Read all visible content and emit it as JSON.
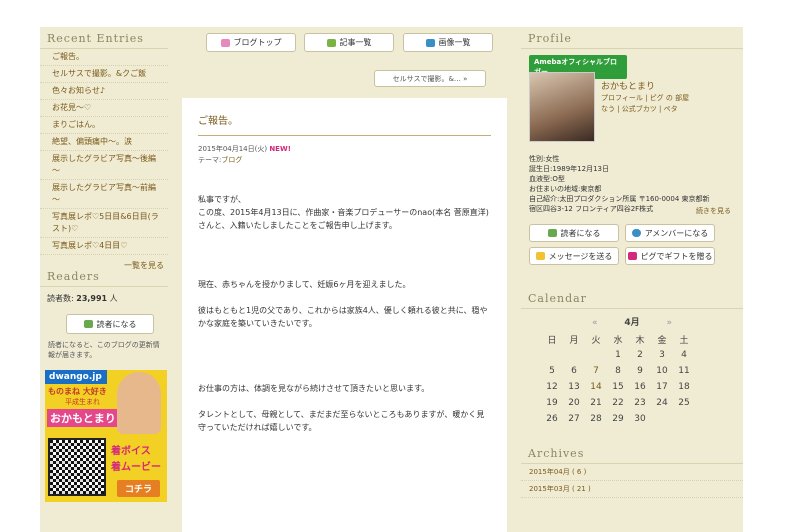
{
  "recent_entries": {
    "title": "Recent Entries",
    "items": [
      "ご報告。",
      "セルサスで撮影。&クご飯",
      "色々お知らせ♪",
      "お花見～♡",
      "まりごはん。",
      "絶望、偏頭痛中～。涙",
      "展示したグラビア写真～後編～",
      "展示したグラビア写真～前編～",
      "写真展レポ♡5日目&6日目(ラスト)♡",
      "写真展レポ♡4日目♡"
    ],
    "more": "一覧を見る"
  },
  "readers": {
    "title": "Readers",
    "count_label": "読者数:",
    "count": "23,991",
    "unit": "人",
    "button": "読者になる",
    "note": "読者になると、このブログの更新情報が届きます。"
  },
  "banner": {
    "top": "dwango.jp",
    "line1": "ものまね 大好き",
    "line2": "平成生まれ",
    "name": "おかもとまり",
    "voice": "着ボイス",
    "movie": "着ムービー",
    "cta": "コチラ"
  },
  "nav": {
    "blog_top": "ブログトップ",
    "entries": "記事一覧",
    "images": "画像一覧",
    "next": "セルサスで撮影。&… »"
  },
  "post": {
    "title": "ご報告。",
    "date": "2015年04月14日(火)",
    "new": "NEW!",
    "theme_label": "テーマ:",
    "theme": "ブログ",
    "p1": "私事ですが、",
    "p2": "この度、2015年4月13日に、作曲家・音楽プロデューサーのnao(本名 菅原直洋)さんと、入籍いたしましたことをご報告申し上げます。",
    "p3": "現在、赤ちゃんを授かりまして、妊娠6ヶ月を迎えました。",
    "p4": "彼はもともと1児の父であり、これからは家族4人、優しく頼れる彼と共に、穏やかな家庭を築いていきたいです。",
    "p5": "お仕事の方は、体調を見ながら続けさせて頂きたいと思います。",
    "p6": "タレントとして、母親として、まだまだ至らないところもありますが、暖かく見守っていただければ嬉しいです。"
  },
  "profile": {
    "title": "Profile",
    "badge": "Amebaオフィシャルブロガー",
    "name": "おかもとまり",
    "links1": "プロフィール | ピグ の 部屋",
    "links2": "なう | 公式ブカツ | ペタ",
    "sex": "性別:女性",
    "birthday": "誕生日:1989年12月13日",
    "blood": "血液型:O型",
    "residence": "お住まいの地域:東京都",
    "intro1": "自己紹介:太田プロダクション所属 〒160-0004 東京都新",
    "intro2": "宿区四谷3-12 フロンティア四谷2F株式",
    "more": "続きを見る",
    "buttons": [
      "読者になる",
      "アメンバーになる",
      "メッセージを送る",
      "ピグでギフトを贈る"
    ]
  },
  "calendar": {
    "title": "Calendar",
    "prev": "«",
    "month": "4月",
    "next": "»",
    "days": [
      "日",
      "月",
      "火",
      "水",
      "木",
      "金",
      "土"
    ],
    "weeks": [
      [
        "",
        "",
        "",
        "1",
        "2",
        "3",
        "4"
      ],
      [
        "5",
        "6",
        "7",
        "8",
        "9",
        "10",
        "11"
      ],
      [
        "12",
        "13",
        "14",
        "15",
        "16",
        "17",
        "18"
      ],
      [
        "19",
        "20",
        "21",
        "22",
        "23",
        "24",
        "25"
      ],
      [
        "26",
        "27",
        "28",
        "29",
        "30",
        "",
        ""
      ]
    ]
  },
  "archives": {
    "title": "Archives",
    "items": [
      "2015年04月 ( 6 )",
      "2015年03月 ( 21 )"
    ]
  },
  "colors": {
    "bg": "#f0ecd4",
    "link": "#7a5a1a",
    "new": "#d4287a",
    "badge": "#2f9d3a"
  }
}
